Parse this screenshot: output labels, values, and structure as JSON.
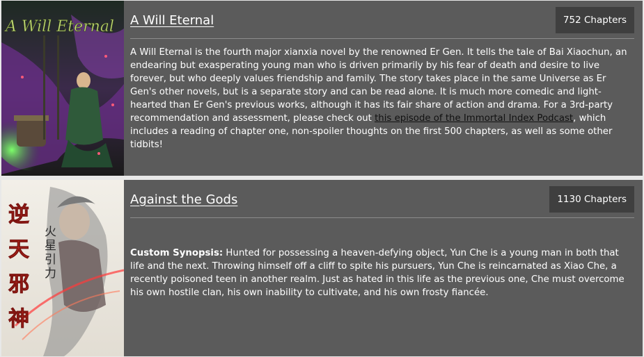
{
  "novels": [
    {
      "title": "A Will Eternal",
      "chapters": "752 Chapters",
      "cover_text": "A Will Eternal",
      "synopsis_before": "A Will Eternal is the fourth major xianxia novel by the renowned Er Gen. It tells the tale of Bai Xiaochun, an endearing but exasperating young man who is driven primarily by his fear of death and desire to live forever, but who deeply values friendship and family. The story takes place in the same Universe as Er Gen's other novels, but is a separate story and can be read alone. It is much more comedic and light-hearted than Er Gen's previous works, although it has its fair share of action and drama. For a 3rd-party recommendation and assessment, please check out ",
      "synopsis_link": "this episode of the Immortal Index Podcast",
      "synopsis_after": ", which includes a reading of chapter one, non-spoiler thoughts on the first 500 chapters, as well as some other tidbits!"
    },
    {
      "title": "Against the Gods",
      "chapters": "1130 Chapters",
      "cover_text": "逆天邪神",
      "cover_author": "火星引力",
      "synopsis_label": "Custom Synopsis:",
      "synopsis": " Hunted for possessing a heaven-defying object, Yun Che is a young man in both that life and the next. Throwing himself off a cliff to spite his pursuers, Yun Che is reincarnated as Xiao Che, a recently poisoned teen in another realm. Just as hated in this life as the previous one, Che must overcome his own hostile clan, his own inability to cultivate, and his own frosty fiancée."
    }
  ],
  "colors": {
    "panel": "#5b5b5b",
    "badge": "#3f3f3f",
    "page": "#e8e8e8",
    "link": "#111111"
  }
}
